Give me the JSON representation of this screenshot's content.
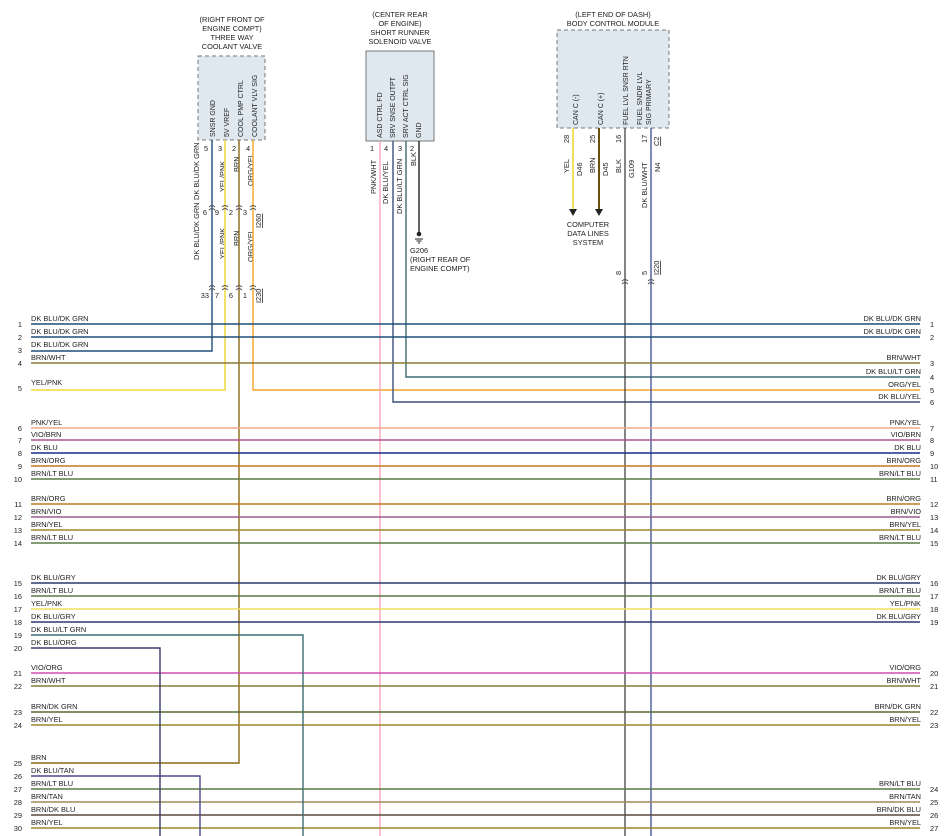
{
  "components": {
    "coolant_valve": {
      "location": [
        "(RIGHT FRONT OF",
        "ENGINE COMPT)"
      ],
      "name": [
        "THREE WAY",
        "COOLANT VALVE"
      ],
      "pins": [
        {
          "num": "5",
          "label": "SNSR GND"
        },
        {
          "num": "3",
          "label": "5V VREF"
        },
        {
          "num": "2",
          "label": "COOL PMP CTRL"
        },
        {
          "num": "4",
          "label": "COOLANT VLV SIG"
        }
      ]
    },
    "solenoid_valve": {
      "location": [
        "(CENTER REAR",
        "OF ENGINE)"
      ],
      "name": [
        "SHORT RUNNER",
        "SOLENOID VALVE"
      ],
      "pins": [
        {
          "num": "1",
          "label": "ASD CTRL FD"
        },
        {
          "num": "4",
          "label": "SRV SNSE OUTPT"
        },
        {
          "num": "3",
          "label": "SRV ACT CTRL SIG"
        },
        {
          "num": "2",
          "label": "GND"
        }
      ]
    },
    "bcm": {
      "location": [
        "(LEFT END OF DASH)"
      ],
      "name": [
        "BODY CONTROL MODULE"
      ],
      "pins": [
        {
          "num": "28",
          "label": "CAN C (-)"
        },
        {
          "num": "25",
          "label": "CAN C (+)"
        },
        {
          "num": "16",
          "label": "FUEL LVL SNSR RTN"
        },
        {
          "num": "17",
          "label": "FUEL SNDR LVL SIG PRIMARY"
        }
      ],
      "c_label": "C2"
    }
  },
  "valve_wires": [
    {
      "color": "DK BLU/DK GRN",
      "stroke": "#1f4e79"
    },
    {
      "color": "YEL/PNK",
      "stroke": "#f2df5a"
    },
    {
      "color": "BRN",
      "stroke": "#8b6914"
    },
    {
      "color": "ORG/YEL",
      "stroke": "#f5a623"
    }
  ],
  "connector_marks": {
    "upper": [
      {
        "pin": "6",
        "ref": ""
      },
      {
        "pin": "9",
        "ref": ""
      },
      {
        "pin": "2",
        "ref": ""
      },
      {
        "pin": "3",
        "ref": "I260"
      }
    ],
    "lower": [
      {
        "pin": "33",
        "ref": ""
      },
      {
        "pin": "7",
        "ref": ""
      },
      {
        "pin": "6",
        "ref": ""
      },
      {
        "pin": "1",
        "ref": "I230"
      }
    ]
  },
  "solenoid_wires": [
    {
      "color": "PNK/WHT",
      "stroke": "#f4a7b9"
    },
    {
      "color": "DK BLU/YEL",
      "stroke": "#3b4f7a"
    },
    {
      "color": "DK BLU/LT GRN",
      "stroke": "#3d6b73"
    },
    {
      "color": "BLK",
      "stroke": "#222222"
    }
  ],
  "ground": {
    "label": "G206",
    "location": [
      "(RIGHT REAR OF",
      "ENGINE COMPT)"
    ]
  },
  "bcm_wires": [
    {
      "color": "YEL",
      "circuit": "D46",
      "stroke": "#f2df5a"
    },
    {
      "color": "BRN",
      "circuit": "D45",
      "stroke": "#6b4f10"
    },
    {
      "color": "BLK",
      "circuit": "G109",
      "stroke": "#333333"
    },
    {
      "color": "DK BLU/WHT",
      "circuit": "N4",
      "stroke": "#2b3c8c"
    }
  ],
  "bcm_bottom_pins": [
    {
      "pin": "8",
      "ref": ""
    },
    {
      "pin": "5",
      "ref": "I220"
    }
  ],
  "data_lines_label": [
    "COMPUTER",
    "DATA LINES",
    "SYSTEM"
  ],
  "left_rows": [
    {
      "n": "1",
      "label": "DK BLU/DK GRN",
      "color": "#1f4e79"
    },
    {
      "n": "2",
      "label": "DK BLU/DK GRN",
      "color": "#1f4e79"
    },
    {
      "n": "3",
      "label": "DK BLU/DK GRN",
      "color": "#1f4e79"
    },
    {
      "n": "4",
      "label": "BRN/WHT",
      "color": "#8b7a3a"
    },
    {
      "n": "5",
      "label": "YEL/PNK",
      "color": "#f2df5a"
    },
    {
      "n": "6",
      "label": "PNK/YEL",
      "color": "#f4a58a"
    },
    {
      "n": "7",
      "label": "VIO/BRN",
      "color": "#b0528f"
    },
    {
      "n": "8",
      "label": "DK BLU",
      "color": "#1b2a8c"
    },
    {
      "n": "9",
      "label": "BRN/ORG",
      "color": "#c47a1a"
    },
    {
      "n": "10",
      "label": "BRN/LT BLU",
      "color": "#5a7a45"
    },
    {
      "n": "11",
      "label": "BRN/ORG",
      "color": "#c47a1a"
    },
    {
      "n": "12",
      "label": "BRN/VIO",
      "color": "#a05a8a"
    },
    {
      "n": "13",
      "label": "BRN/YEL",
      "color": "#9a8a2a"
    },
    {
      "n": "14",
      "label": "BRN/LT BLU",
      "color": "#5a7a45"
    },
    {
      "n": "15",
      "label": "DK BLU/GRY",
      "color": "#2a3a6a"
    },
    {
      "n": "16",
      "label": "BRN/LT BLU",
      "color": "#5a7a45"
    },
    {
      "n": "17",
      "label": "YEL/PNK",
      "color": "#f2df5a"
    },
    {
      "n": "18",
      "label": "DK BLU/GRY",
      "color": "#2a3a6a"
    },
    {
      "n": "19",
      "label": "DK BLU/LT GRN",
      "color": "#3d6b73"
    },
    {
      "n": "20",
      "label": "DK BLU/ORG",
      "color": "#3a3a6a"
    },
    {
      "n": "21",
      "label": "VIO/ORG",
      "color": "#d04fb0"
    },
    {
      "n": "22",
      "label": "BRN/WHT",
      "color": "#8b7a3a"
    },
    {
      "n": "23",
      "label": "BRN/DK GRN",
      "color": "#556b2f"
    },
    {
      "n": "24",
      "label": "BRN/YEL",
      "color": "#9a8a2a"
    },
    {
      "n": "25",
      "label": "BRN",
      "color": "#8b6914"
    },
    {
      "n": "26",
      "label": "DK BLU/TAN",
      "color": "#4a4a8a"
    },
    {
      "n": "27",
      "label": "BRN/LT BLU",
      "color": "#5a7a45"
    },
    {
      "n": "28",
      "label": "BRN/TAN",
      "color": "#a08a5a"
    },
    {
      "n": "29",
      "label": "BRN/DK BLU",
      "color": "#5a4a3a"
    },
    {
      "n": "30",
      "label": "BRN/YEL",
      "color": "#9a8a2a"
    }
  ],
  "right_rows": [
    {
      "n": "1",
      "label": "DK BLU/DK GRN"
    },
    {
      "n": "2",
      "label": "DK BLU/DK GRN"
    },
    {
      "n": "3",
      "label": "BRN/WHT"
    },
    {
      "n": "4",
      "label": "DK BLU/LT GRN"
    },
    {
      "n": "5",
      "label": "ORG/YEL"
    },
    {
      "n": "6",
      "label": "DK BLU/YEL"
    },
    {
      "n": "7",
      "label": "PNK/YEL"
    },
    {
      "n": "8",
      "label": "VIO/BRN"
    },
    {
      "n": "9",
      "label": "DK BLU"
    },
    {
      "n": "10",
      "label": "BRN/ORG"
    },
    {
      "n": "11",
      "label": "BRN/LT BLU"
    },
    {
      "n": "12",
      "label": "BRN/ORG"
    },
    {
      "n": "13",
      "label": "BRN/VIO"
    },
    {
      "n": "14",
      "label": "BRN/YEL"
    },
    {
      "n": "15",
      "label": "BRN/LT BLU"
    },
    {
      "n": "16",
      "label": "DK BLU/GRY"
    },
    {
      "n": "17",
      "label": "BRN/LT BLU"
    },
    {
      "n": "18",
      "label": "YEL/PNK"
    },
    {
      "n": "19",
      "label": "DK BLU/GRY"
    },
    {
      "n": "20",
      "label": "VIO/ORG"
    },
    {
      "n": "21",
      "label": "BRN/WHT"
    },
    {
      "n": "22",
      "label": "BRN/DK GRN"
    },
    {
      "n": "23",
      "label": "BRN/YEL"
    },
    {
      "n": "24",
      "label": "BRN/LT BLU"
    },
    {
      "n": "25",
      "label": "BRN/TAN"
    },
    {
      "n": "26",
      "label": "BRN/DK BLU"
    },
    {
      "n": "27",
      "label": "BRN/YEL"
    }
  ]
}
